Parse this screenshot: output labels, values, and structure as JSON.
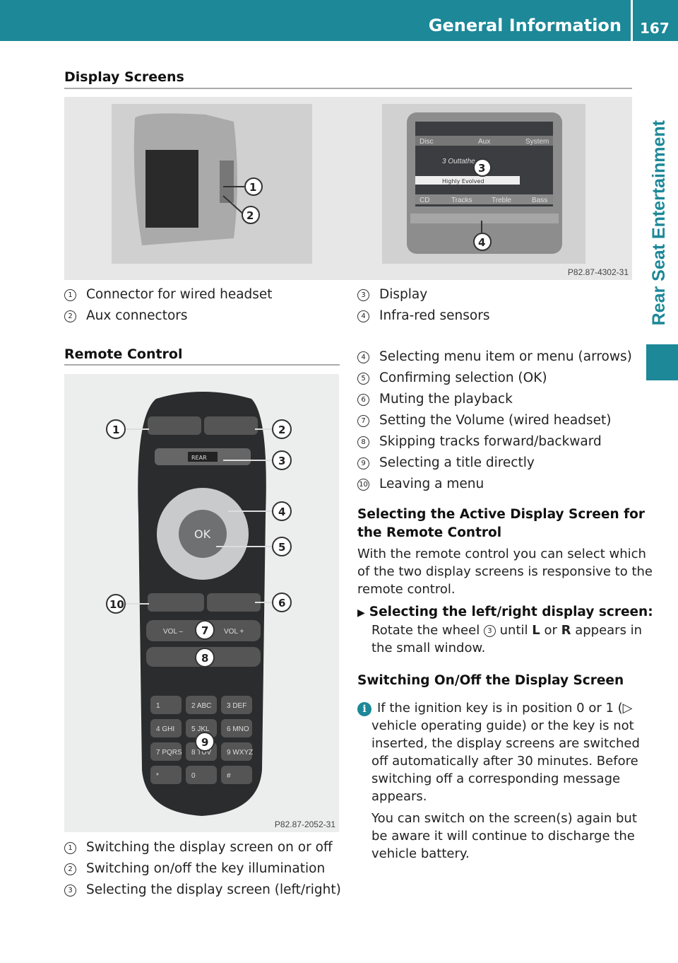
{
  "header": {
    "title": "General Information",
    "page": "167"
  },
  "side_tab": "Rear Seat Entertainment",
  "display_screens": {
    "heading": "Display Screens",
    "figure_code": "P82.87-4302-31",
    "callouts": [
      "1",
      "2",
      "3",
      "4"
    ],
    "screen_ui": {
      "top": [
        "Disc",
        "Aux",
        "System"
      ],
      "track": "3 Outtathe...",
      "title": "Highly Evolved",
      "bottom": [
        "CD",
        "Tracks",
        "Treble",
        "Bass"
      ]
    },
    "legend_left": [
      {
        "n": "1",
        "text": "Connector for wired headset"
      },
      {
        "n": "2",
        "text": "Aux connectors"
      }
    ],
    "legend_right": [
      {
        "n": "3",
        "text": "Display"
      },
      {
        "n": "4",
        "text": "Infra-red sensors"
      }
    ]
  },
  "remote_control": {
    "heading": "Remote Control",
    "figure_code": "P82.87-2052-31",
    "callouts": [
      "1",
      "2",
      "3",
      "4",
      "5",
      "6",
      "7",
      "8",
      "9",
      "10"
    ],
    "buttons": {
      "ok": "OK",
      "vol_minus": "VOL –",
      "vol_plus": "VOL +",
      "rear": "REAR",
      "keys": [
        "1",
        "2 ABC",
        "3 DEF",
        "4 GHI",
        "5 JKL",
        "6 MNO",
        "7 PQRS",
        "8 TUV",
        "9 WXYZ",
        "*",
        "0",
        "#"
      ]
    },
    "legend_bottom": [
      {
        "n": "1",
        "text": "Switching the display screen on or off"
      },
      {
        "n": "2",
        "text": "Switching on/off the key illumination"
      },
      {
        "n": "3",
        "text": "Selecting the display screen (left/right)"
      }
    ],
    "legend_right": [
      {
        "n": "4",
        "text": "Selecting menu item or menu (arrows)"
      },
      {
        "n": "5",
        "text": "Confirming selection (OK)"
      },
      {
        "n": "6",
        "text": "Muting the playback"
      },
      {
        "n": "7",
        "text": "Setting the Volume (wired headset)"
      },
      {
        "n": "8",
        "text": "Skipping tracks forward/backward"
      },
      {
        "n": "9",
        "text": "Selecting a title directly"
      },
      {
        "n": "10",
        "text": "Leaving a menu"
      }
    ]
  },
  "active_screen": {
    "heading_1": "Selecting the Active Display Screen for",
    "heading_2": "the Remote Control",
    "para": [
      "With the remote control you can select which",
      "of the two display screens is responsive to the",
      "remote control."
    ],
    "step_title": "Selecting the left/right display screen:",
    "step_a": "Rotate the wheel ",
    "step_n": "3",
    "step_b": " until ",
    "L": "L",
    "or": " or ",
    "R": "R",
    "step_c": " appears in",
    "step_d": "the small window."
  },
  "switching": {
    "heading": "Switching On/Off the Display Screen",
    "info_icon": "i",
    "info": [
      "If the ignition key is in position 0 or 1 (▷",
      "vehicle operating guide) or the key is not",
      "inserted, the display screens are switched",
      "off automatically after 30 minutes. Before",
      "switching off a corresponding message",
      "appears."
    ],
    "para2": [
      "You can switch on the screen(s) again but",
      "be aware it will continue to discharge the",
      "vehicle battery."
    ]
  },
  "colors": {
    "accent": "#1c8898"
  }
}
